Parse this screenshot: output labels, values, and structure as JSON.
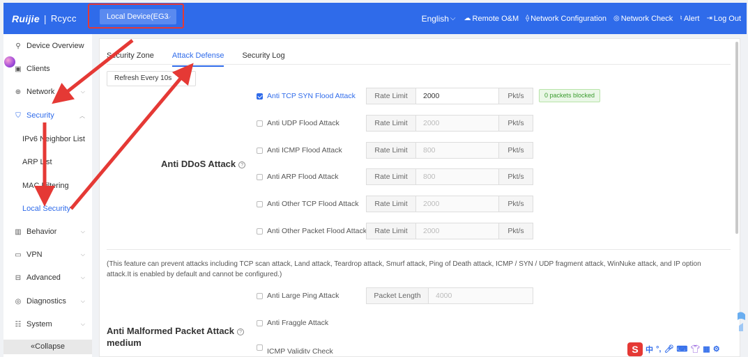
{
  "topbar": {
    "brand": "Ruijie",
    "brand_sub": "Rcycc",
    "device_select": "Local Device(EG3",
    "language": "English",
    "links": [
      "Remote O&M",
      "Network Configuration",
      "Network Check",
      "Alert",
      "Log Out"
    ]
  },
  "sidebar": {
    "items": [
      {
        "label": "Device Overview",
        "icon": "topology-icon"
      },
      {
        "label": "Clients",
        "icon": "clients-icon"
      },
      {
        "label": "Network",
        "icon": "globe-icon"
      },
      {
        "label": "Security",
        "icon": "shield-icon"
      },
      {
        "label": "Behavior",
        "icon": "chart-icon"
      },
      {
        "label": "VPN",
        "icon": "monitor-icon"
      },
      {
        "label": "Advanced",
        "icon": "briefcase-icon"
      },
      {
        "label": "Diagnostics",
        "icon": "diagnostics-icon"
      },
      {
        "label": "System",
        "icon": "settings-icon"
      }
    ],
    "security_sub": [
      "IPv6 Neighbor List",
      "ARP List",
      "MAC Filtering",
      "Local Security"
    ],
    "collapse": "«Collapse"
  },
  "tabs": [
    "Security Zone",
    "Attack Defense",
    "Security Log"
  ],
  "refresh": "Refresh Every 10s",
  "ddos": {
    "title": "Anti DDoS Attack",
    "prefix": "Rate Limit",
    "unit": "Pkt/s",
    "blocked": "0 packets blocked",
    "rules": [
      {
        "label": "Anti TCP SYN Flood Attack",
        "value": "2000",
        "checked": true
      },
      {
        "label": "Anti UDP Flood Attack",
        "value": "2000",
        "checked": false
      },
      {
        "label": "Anti ICMP Flood Attack",
        "value": "800",
        "checked": false
      },
      {
        "label": "Anti ARP Flood Attack",
        "value": "800",
        "checked": false
      },
      {
        "label": "Anti Other TCP Flood Attack",
        "value": "2000",
        "checked": false
      },
      {
        "label": "Anti Other Packet Flood Attack",
        "value": "2000",
        "checked": false
      }
    ]
  },
  "note": "(This feature can prevent attacks including TCP scan attack, Land attack, Teardrop attack, Smurf attack, Ping of Death attack, ICMP / SYN / UDP fragment attack, WinNuke attack, and IP option attack.It is enabled by default and cannot be configured.)",
  "malformed": {
    "title": "Anti Malformed Packet Attack",
    "level": "medium",
    "rules": [
      {
        "label": "Anti Large Ping Attack",
        "prefix": "Packet Length",
        "value": "4000"
      },
      {
        "label": "Anti Fraggle Attack"
      },
      {
        "label": "ICMP Validity Check"
      }
    ]
  },
  "tray": [
    "中",
    "°,"
  ],
  "colors": {
    "primary": "#2f6bea",
    "annotation": "#e53935",
    "badge_green": "#3a9b2e"
  }
}
